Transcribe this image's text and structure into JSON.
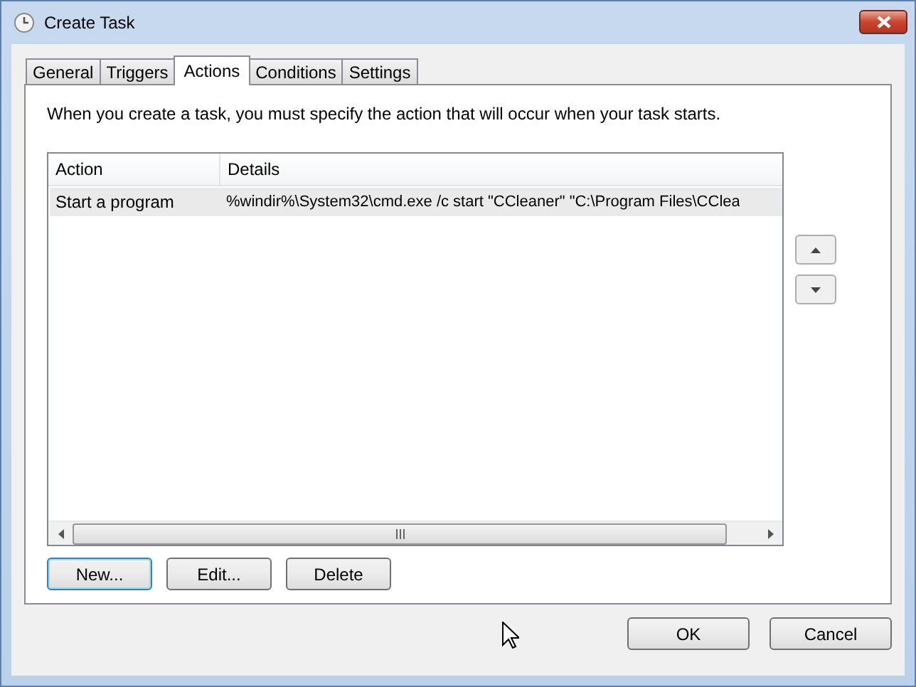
{
  "window": {
    "title": "Create Task"
  },
  "tabs": [
    {
      "label": "General",
      "selected": false
    },
    {
      "label": "Triggers",
      "selected": false
    },
    {
      "label": "Actions",
      "selected": true
    },
    {
      "label": "Conditions",
      "selected": false
    },
    {
      "label": "Settings",
      "selected": false
    }
  ],
  "description": "When you create a task, you must specify the action that will occur when your task starts.",
  "table": {
    "columns": [
      "Action",
      "Details"
    ],
    "rows": [
      {
        "cells": [
          "Start a program",
          "%windir%\\System32\\cmd.exe /c start \"CCleaner\" \"C:\\Program Files\\CClea"
        ],
        "selected": true
      }
    ]
  },
  "action_buttons": [
    {
      "label": "New...",
      "focused": true
    },
    {
      "label": "Edit...",
      "focused": false
    },
    {
      "label": "Delete",
      "focused": false
    }
  ],
  "dialog_buttons": [
    {
      "label": "OK"
    },
    {
      "label": "Cancel"
    }
  ]
}
